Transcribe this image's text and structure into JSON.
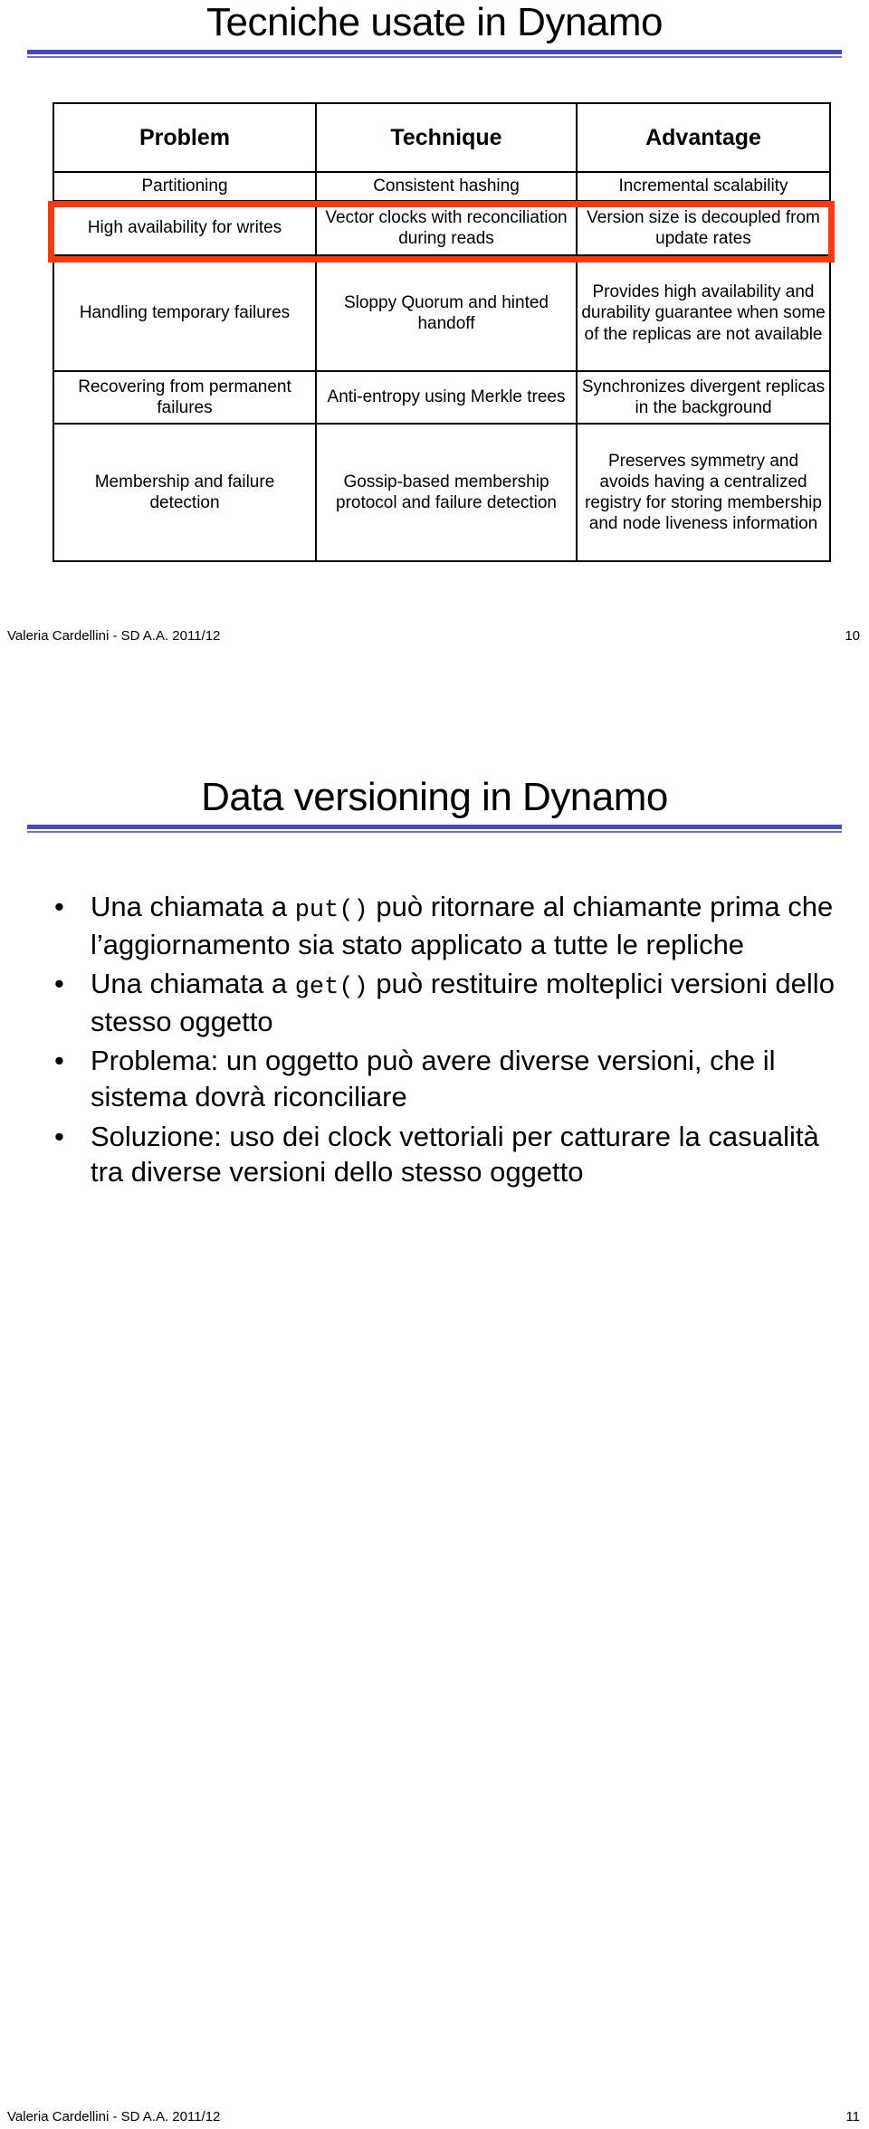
{
  "slide1": {
    "title": "Tecniche usate in Dynamo",
    "table": {
      "headers": [
        "Problem",
        "Technique",
        "Advantage"
      ],
      "rows": [
        {
          "problem": "Partitioning",
          "technique": "Consistent hashing",
          "advantage": "Incremental scalability"
        },
        {
          "problem": "High availability for writes",
          "technique": "Vector clocks with reconciliation during reads",
          "advantage": "Version size is decoupled from update rates"
        },
        {
          "problem": "Handling temporary failures",
          "technique": "Sloppy Quorum and hinted handoff",
          "advantage": "Provides high availability and durability guarantee when some of the replicas are not available"
        },
        {
          "problem": "Recovering from permanent failures",
          "technique": "Anti-entropy using Merkle trees",
          "advantage": "Synchronizes divergent replicas in the background"
        },
        {
          "problem": "Membership and failure detection",
          "technique": "Gossip-based membership protocol and failure detection",
          "advantage": "Preserves symmetry and avoids having a centralized registry for storing membership and node liveness information"
        }
      ],
      "highlight_row_index": 1,
      "highlight_color": "#F73A10"
    },
    "footer": {
      "author": "Valeria Cardellini - SD A.A. 2011/12",
      "page": "10"
    }
  },
  "slide2": {
    "title": "Data versioning in Dynamo",
    "bullet_char": "•",
    "bullets": [
      {
        "parts": [
          {
            "type": "text",
            "value": "Una chiamata a "
          },
          {
            "type": "code",
            "value": "put()"
          },
          {
            "type": "text",
            "value": " può ritornare al chiamante prima che l’aggiornamento sia stato applicato a tutte le repliche"
          }
        ]
      },
      {
        "parts": [
          {
            "type": "text",
            "value": "Una chiamata a "
          },
          {
            "type": "code",
            "value": "get()"
          },
          {
            "type": "text",
            "value": " può restituire molteplici versioni dello stesso oggetto"
          }
        ]
      },
      {
        "parts": [
          {
            "type": "text",
            "value": "Problema: un oggetto può avere diverse versioni, che il sistema dovrà riconciliare"
          }
        ]
      },
      {
        "parts": [
          {
            "type": "text",
            "value": "Soluzione: uso dei clock vettoriali per catturare la casualità tra diverse versioni dello stesso oggetto"
          }
        ]
      }
    ],
    "footer": {
      "author": "Valeria Cardellini - SD A.A. 2011/12",
      "page": "11"
    }
  },
  "theme": {
    "rule_color": "#4949BD",
    "rule_color_light": "#6F6FD0",
    "text_color": "#000000",
    "background": "#ffffff"
  }
}
